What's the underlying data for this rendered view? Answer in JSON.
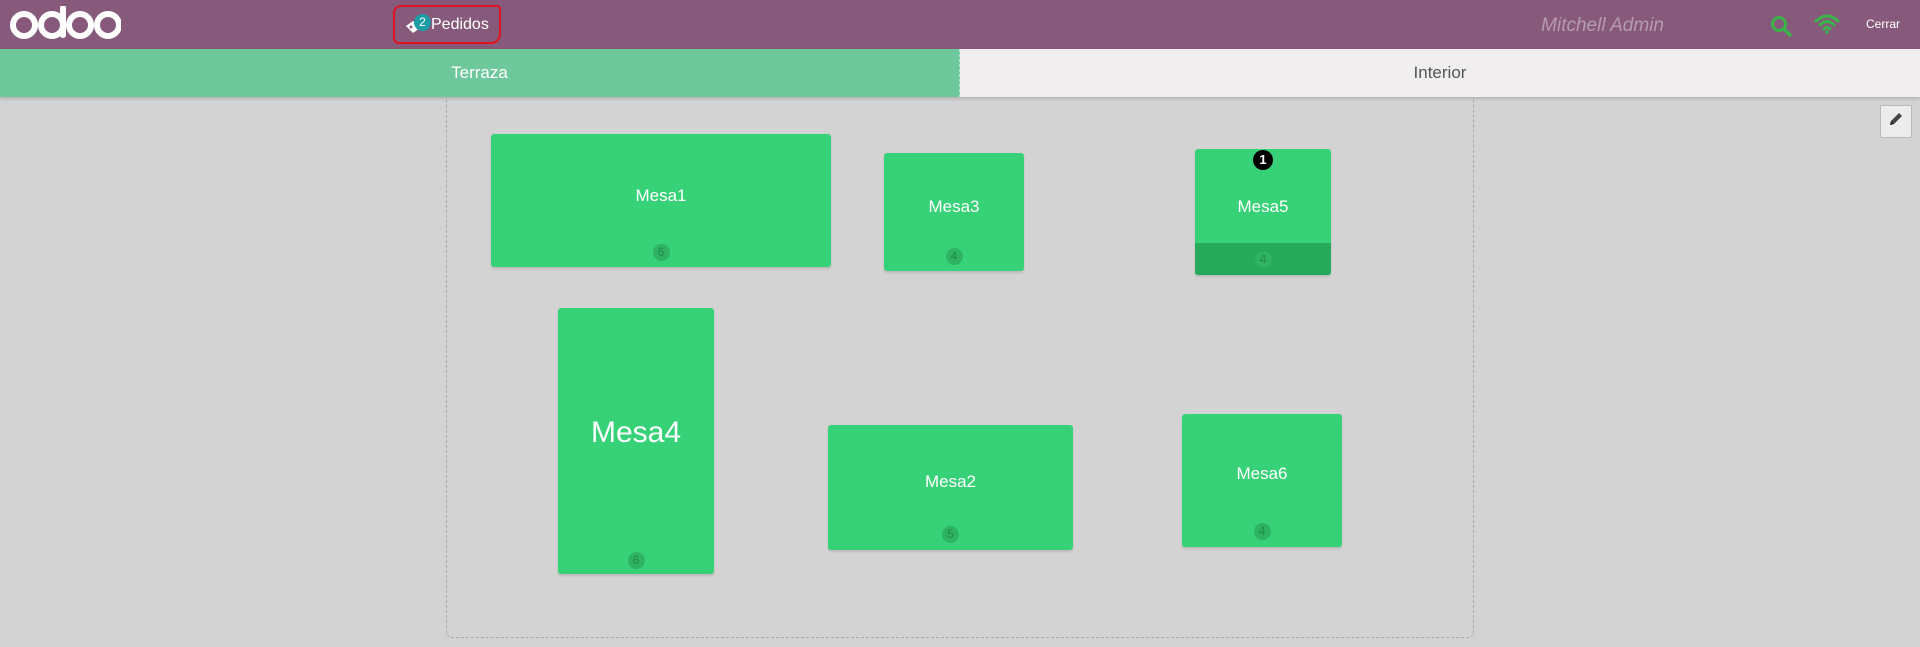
{
  "header": {
    "logo_text": "odoo",
    "orders": {
      "label": "Pedidos",
      "count": "2"
    },
    "user_name": "Mitchell Admin",
    "close_label": "Cerrar",
    "accent_search": "#3bb34a",
    "accent_wifi": "#3bb34a"
  },
  "floors": [
    {
      "label": "Terraza",
      "active": true
    },
    {
      "label": "Interior",
      "active": false
    }
  ],
  "tables": [
    {
      "name": "Mesa1",
      "seats": "6"
    },
    {
      "name": "Mesa3",
      "seats": "4"
    },
    {
      "name": "Mesa5",
      "seats": "4",
      "orders": "1"
    },
    {
      "name": "Mesa4",
      "seats": "6"
    },
    {
      "name": "Mesa2",
      "seats": "5"
    },
    {
      "name": "Mesa6",
      "seats": "4"
    }
  ],
  "colors": {
    "topbar": "#875a7b",
    "table": "#37d277",
    "active_floor": "#6ec89b",
    "floor_background": "#d3d3d3"
  }
}
